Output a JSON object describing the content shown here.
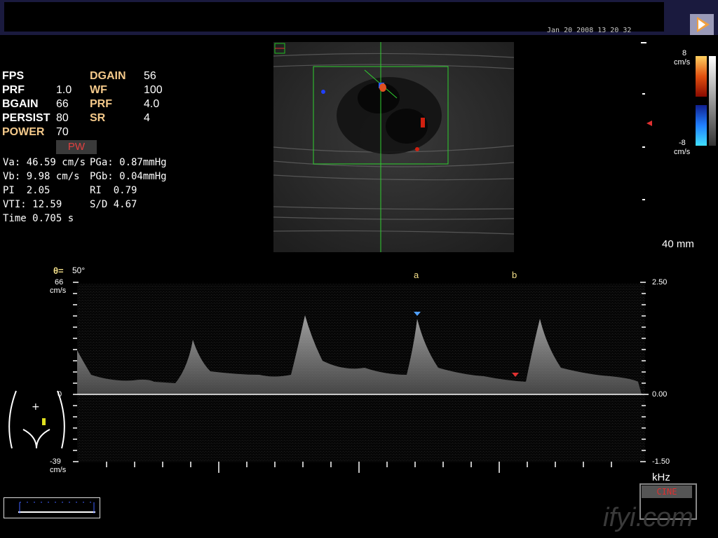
{
  "header": {
    "datetime": "Jan 20 2008 13 20 32"
  },
  "params": {
    "left": [
      {
        "label": "FPS",
        "value": ""
      },
      {
        "label": "PRF",
        "value": "1.0"
      },
      {
        "label": "BGAIN",
        "value": "66"
      },
      {
        "label": "PERSIST",
        "value": "80"
      },
      {
        "label": "POWER",
        "value": "70"
      }
    ],
    "right": [
      {
        "label": "DGAIN",
        "value": "56"
      },
      {
        "label": "WF",
        "value": "100"
      },
      {
        "label": "PRF",
        "value": "4.0"
      },
      {
        "label": "SR",
        "value": "4"
      }
    ],
    "mode_button": "PW"
  },
  "measurements": {
    "va": "Va: 46.59 cm/s",
    "vb": "Vb: 9.98 cm/s",
    "pi": "PI  2.05",
    "vti": "VTI: 12.59",
    "time": "Time 0.705 s",
    "pga": "PGa: 0.87mmHg",
    "pgb": "PGb: 0.04mmHg",
    "ri": "RI  0.79",
    "sd": "S/D 4.67"
  },
  "color_scale": {
    "top": "8",
    "top_unit": "cm/s",
    "bottom": "-8",
    "bottom_unit": "cm/s"
  },
  "depth": "40 mm",
  "spectral": {
    "angle_symbol": "θ=",
    "angle": "50°",
    "left_top": "66",
    "left_top_unit": "cm/s",
    "left_zero": "0",
    "left_bottom": "-39",
    "left_bottom_unit": "cm/s",
    "right_top": "2.50",
    "right_zero": "0.00",
    "right_bottom": "-1.50",
    "marker_a": "a",
    "marker_b": "b",
    "unit": "kHz"
  },
  "cine_label": "CINE",
  "watermark": "ifyi.com",
  "colors": {
    "label_orange": "#f4c98a",
    "header_bg": "#1a1a3e",
    "cine_red": "#e03030"
  }
}
